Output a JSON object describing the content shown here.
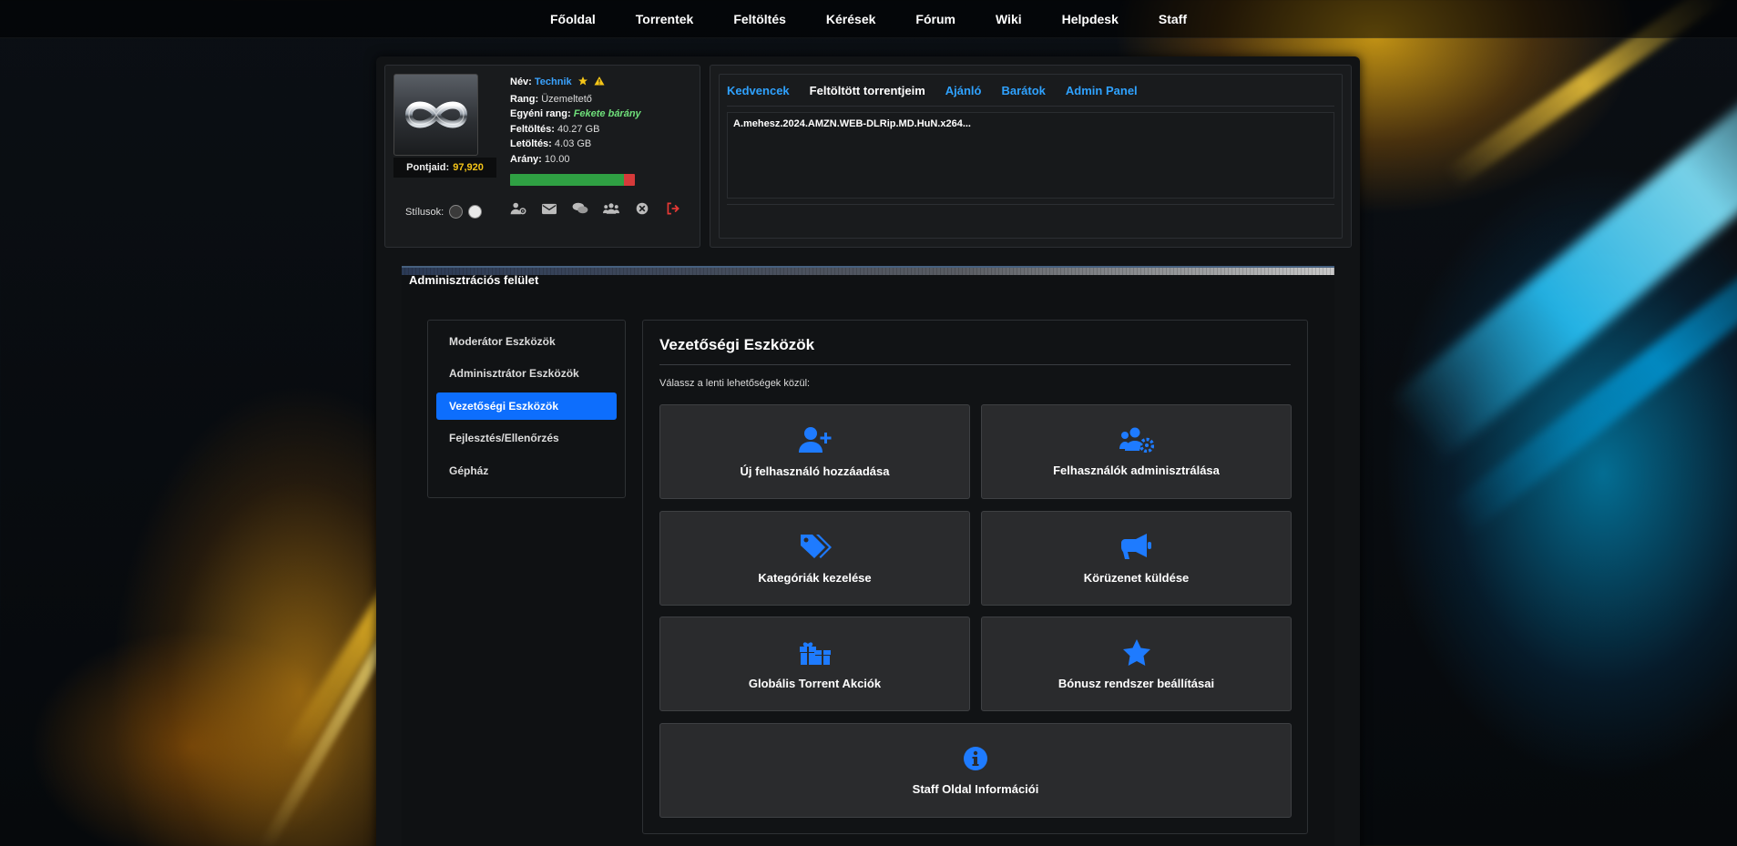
{
  "colors": {
    "accent": "#0d6efd",
    "link": "#2fa2ff",
    "gold": "#f5c518",
    "icon_blue": "#1e7bff"
  },
  "nav": [
    "Főoldal",
    "Torrentek",
    "Feltöltés",
    "Kérések",
    "Fórum",
    "Wiki",
    "Helpdesk",
    "Staff"
  ],
  "profile": {
    "name_label": "Név:",
    "name": "Technik",
    "rank_label": "Rang:",
    "rank": "Üzemeltető",
    "custom_rank_label": "Egyéni rang:",
    "custom_rank": "Fekete bárány",
    "upload_label": "Feltöltés:",
    "upload": "40.27 GB",
    "download_label": "Letöltés:",
    "download": "4.03 GB",
    "ratio_label": "Arány:",
    "ratio": "10.00",
    "points_label": "Pontjaid:",
    "points": "97,920",
    "styles_label": "Stílusok:",
    "ratio_fill_fraction": 0.91,
    "tool_icons": [
      "user-cog-icon",
      "envelope-icon",
      "comments-icon",
      "users-icon",
      "close-circle-icon",
      "logout-icon"
    ]
  },
  "tabs": {
    "items": [
      "Kedvencek",
      "Feltöltött torrentjeim",
      "Ajánló",
      "Barátok",
      "Admin Panel"
    ],
    "active": "Feltöltött torrentjeim",
    "torrents": [
      "A.mehesz.2024.AMZN.WEB-DLRip.MD.HuN.x264..."
    ]
  },
  "admin": {
    "header": "Adminisztrációs felület",
    "menu": [
      "Moderátor Eszközök",
      "Adminisztrátor Eszközök",
      "Vezetőségi Eszközök",
      "Fejlesztés/Ellenőrzés",
      "Gépház"
    ],
    "active_menu": "Vezetőségi Eszközök",
    "panel_title": "Vezetőségi Eszközök",
    "panel_subtitle": "Válassz a lenti lehetőségek közül:",
    "cards": [
      {
        "label": "Új felhasználó hozzáadása",
        "icon": "user-plus-icon"
      },
      {
        "label": "Felhasználók adminisztrálása",
        "icon": "users-cog-icon"
      },
      {
        "label": "Kategóriák kezelése",
        "icon": "tags-icon"
      },
      {
        "label": "Körüzenet küldése",
        "icon": "megaphone-icon"
      },
      {
        "label": "Globális Torrent Akciók",
        "icon": "gifts-icon"
      },
      {
        "label": "Bónusz rendszer beállításai",
        "icon": "star-icon"
      },
      {
        "label": "Staff Oldal Információi",
        "icon": "info-circle-icon"
      }
    ]
  }
}
